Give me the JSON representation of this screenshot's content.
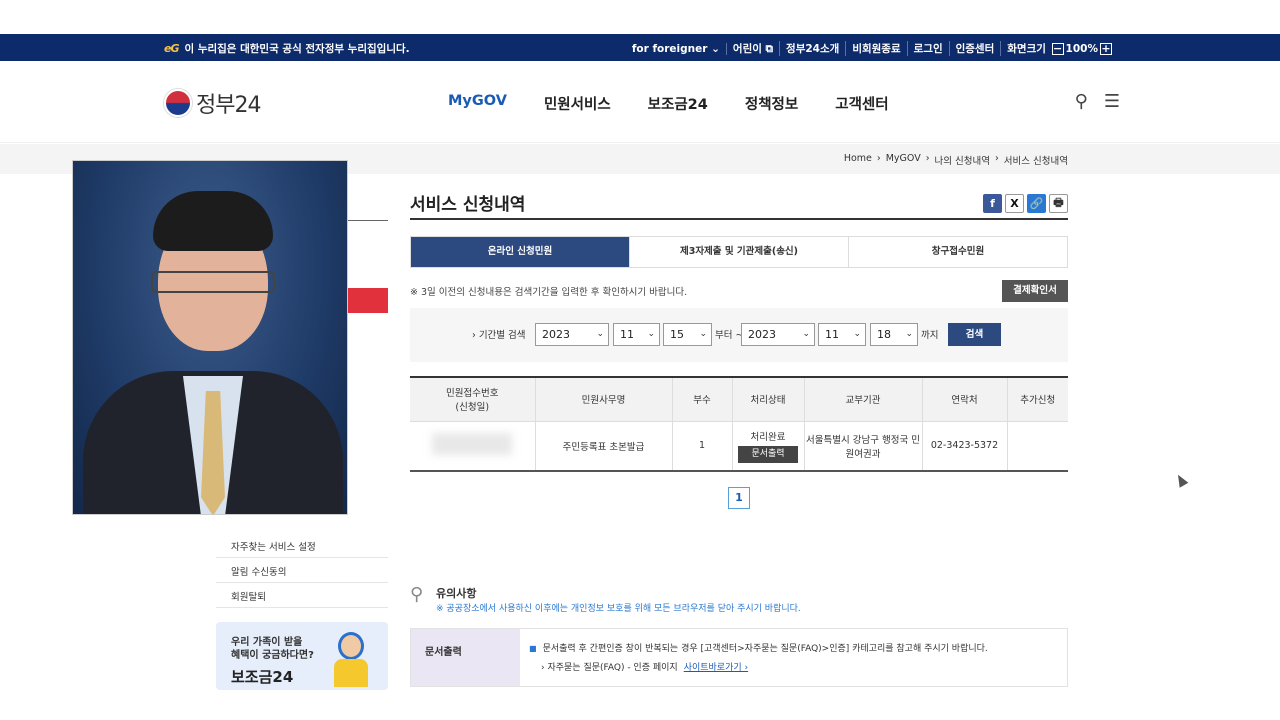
{
  "topbar": {
    "logo_mark": "eG",
    "notice": "이 누리집은 대한민국 공식 전자정부 누리집입니다.",
    "links": [
      "for foreigner",
      "어린이",
      "정부24소개",
      "비회원종료",
      "로그인",
      "인증센터",
      "화면크기"
    ],
    "zoom": "100%"
  },
  "header": {
    "logo_text": "정부24",
    "nav": [
      "MyGOV",
      "민원서비스",
      "보조금24",
      "정책정보",
      "고객센터"
    ],
    "active_nav": "MyGOV",
    "search_icon": "search-icon",
    "menu_icon": "menu-icon"
  },
  "breadcrumb": [
    "Home",
    "MyGOV",
    "나의 신청내역",
    "서비스 신청내역"
  ],
  "sidebar": {
    "links": [
      "자주찾는 서비스 설정",
      "알림 수신동의",
      "회원탈퇴"
    ],
    "banner_line1": "우리 가족이 받을",
    "banner_line2": "혜택이 궁금하다면?",
    "banner_title": "보조금24"
  },
  "main": {
    "title": "서비스 신청내역",
    "share": {
      "facebook": "f",
      "x": "X",
      "link": "🔗",
      "print": "🖶"
    },
    "tabs": [
      "온라인 신청민원",
      "제3자제출 및 기관제출(송신)",
      "창구접수민원"
    ],
    "notice": "※ 3일 이전의 신청내용은 검색기간을 입력한 후 확인하시기 바랍니다.",
    "receipt_button": "결제확인서",
    "search": {
      "label": "› 기간별 검색",
      "from_year": "2023",
      "from_month": "11",
      "from_day": "15",
      "from_word": "부터 ~",
      "to_year": "2023",
      "to_month": "11",
      "to_day": "18",
      "to_word": "까지",
      "button": "검색"
    },
    "table": {
      "headers": [
        "민원접수번호",
        "(신청일)",
        "민원사무명",
        "부수",
        "처리상태",
        "교부기관",
        "연락처",
        "추가신청"
      ],
      "row": {
        "name": "주민등록표 초본발급",
        "count": "1",
        "status": "처리완료",
        "status_button": "문서출력",
        "agency_line1": "서울특별시 강남구 행정국 민",
        "agency_line2": "원여권과",
        "phone": "02-3423-5372",
        "extra": ""
      }
    },
    "page": "1"
  },
  "caution": {
    "title": "유의사항",
    "desc": "※ 공공장소에서 사용하신 이후에는 개인정보 보호를 위해 모든 브라우저를 닫아 주시기 바랍니다."
  },
  "doc_print": {
    "head": "문서출력",
    "line1": "문서출력 후 간편인증 창이 반복되는 경우 [고객센터>자주묻는 질문(FAQ)>인증] 카테고리를 참고해 주시기 바랍니다.",
    "line2": "› 자주묻는 질문(FAQ) - 인증 페이지",
    "link": "사이트바로가기 ›"
  }
}
